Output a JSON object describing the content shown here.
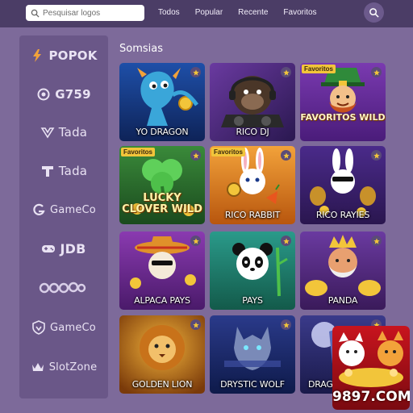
{
  "header": {
    "search_placeholder": "Pesquisar logos",
    "nav": [
      "Todos",
      "Popular",
      "Recente",
      "Favoritos"
    ]
  },
  "sidebar": {
    "brands": [
      {
        "label": "POPOK",
        "icon": "popok-bolt-icon"
      },
      {
        "label": "G759",
        "icon": "g759-ring-icon"
      },
      {
        "label": "Tada",
        "icon": "tada-wings-icon"
      },
      {
        "label": "Tada",
        "icon": "tada-t-icon"
      },
      {
        "label": "GameCo",
        "icon": "gameco-g-icon"
      },
      {
        "label": "JDB",
        "icon": "gamepad-icon"
      },
      {
        "label": "",
        "icon": "cq9-logo-icon"
      },
      {
        "label": "GameCo",
        "icon": "gameco-shield-icon"
      },
      {
        "label": "SlotZone",
        "icon": "crown-icon"
      }
    ]
  },
  "main": {
    "section_title": "Somsias",
    "games": [
      {
        "title": "YO DRAGON",
        "ribbon": "",
        "big": ""
      },
      {
        "title": "RICO DJ",
        "ribbon": "",
        "big": ""
      },
      {
        "title": "",
        "ribbon": "Favoritos",
        "big": "FAVORITOS WILD"
      },
      {
        "title": "",
        "ribbon": "Favoritos",
        "big": "LUCKY CLOVER WILD"
      },
      {
        "title": "RICO RABBIT",
        "ribbon": "Favoritos",
        "big": ""
      },
      {
        "title": "RICO RAYIES",
        "ribbon": "",
        "big": ""
      },
      {
        "title": "ALPACA PAYS",
        "ribbon": "",
        "big": ""
      },
      {
        "title": "PAYS",
        "ribbon": "",
        "big": ""
      },
      {
        "title": "PANDA",
        "ribbon": "",
        "big": ""
      },
      {
        "title": "GOLDEN LION",
        "ribbon": "",
        "big": ""
      },
      {
        "title": "DRYSTIC WOLF",
        "ribbon": "",
        "big": ""
      },
      {
        "title": "DRAGON",
        "ribbon": "",
        "big": ""
      }
    ]
  },
  "promo": {
    "label": "9897.COM"
  },
  "colors": {
    "page_bg": "#7d6a9a",
    "topbar": "#4b3d66",
    "sidebar": "#6a5788",
    "ribbon": "#f2c53a"
  }
}
